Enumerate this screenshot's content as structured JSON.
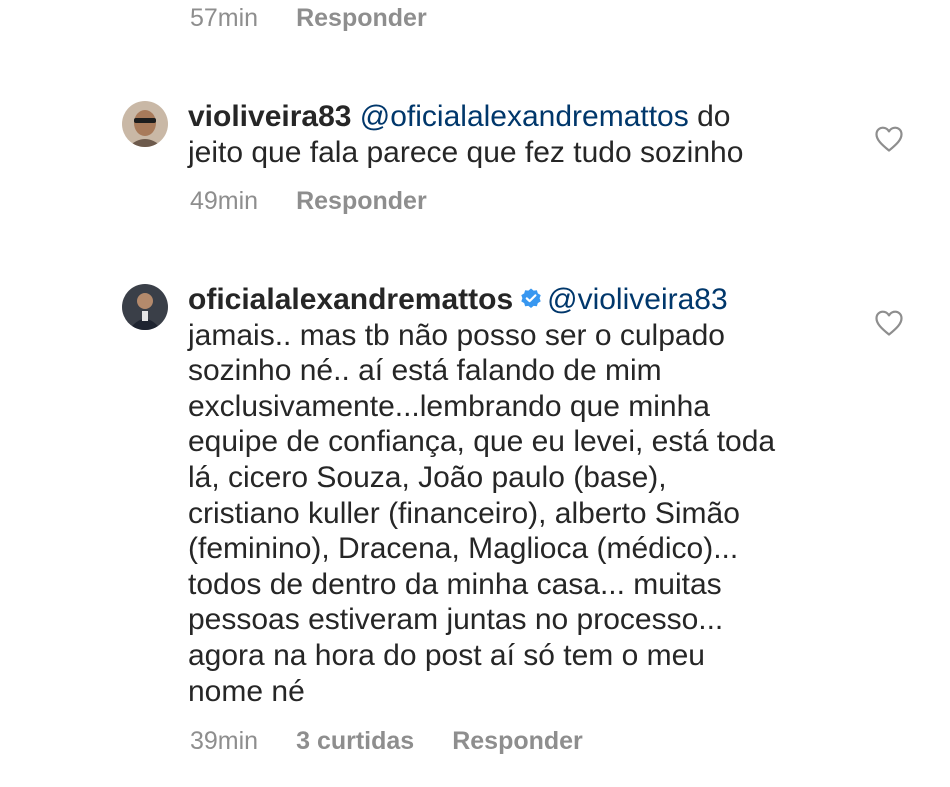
{
  "top_meta": {
    "time": "57min",
    "reply_label": "Responder"
  },
  "comments": [
    {
      "username": "violiveira83",
      "mention": "@oficialalexandremattos",
      "text_first": " do",
      "text_rest": "jeito que fala parece que fez tudo sozinho",
      "time": "49min",
      "reply_label": "Responder"
    },
    {
      "username": "oficialalexandremattos",
      "mention": "@violiveira83",
      "text_rest": "jamais.. mas tb não posso ser o culpado\nsozinho né.. aí está falando de mim\nexclusivamente...lembrando que minha\nequipe de confiança, que eu levei, está toda\nlá, cicero Souza, João paulo (base),\ncristiano kuller (financeiro), alberto Simão\n(feminino), Dracena, Maglioca (médico)...\ntodos de dentro da minha casa... muitas\npessoas estiveram juntas no processo...\nagora na hora do post aí só tem o meu\nnome né",
      "time": "39min",
      "likes": "3 curtidas",
      "reply_label": "Responder"
    }
  ],
  "colors": {
    "meta": "#8e8e8e",
    "mention": "#00376b",
    "verified": "#3897f0"
  },
  "icons": [
    "heart-outline-icon",
    "verified-badge-icon"
  ]
}
